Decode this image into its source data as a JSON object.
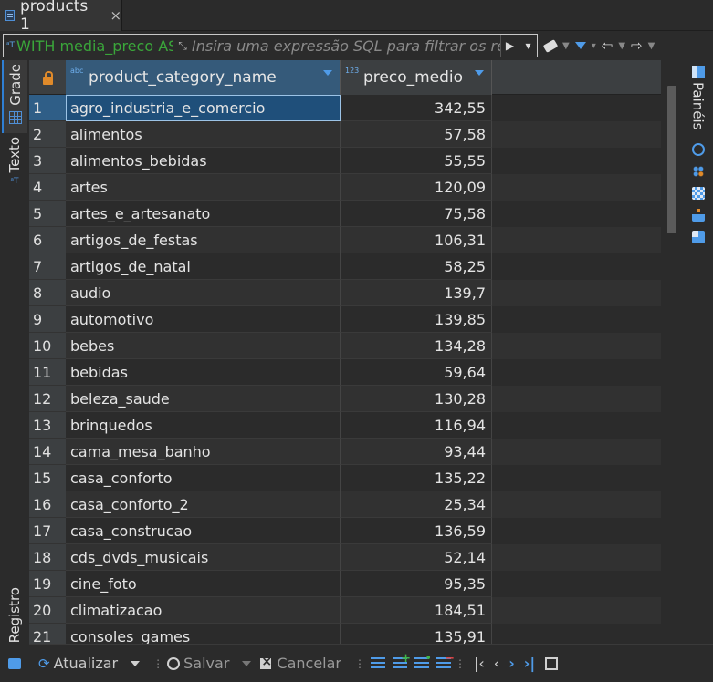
{
  "tab": {
    "title": "products 1",
    "close": "×"
  },
  "filter": {
    "sql_icon": "sql-text-icon",
    "sql_text": "WITH media_preco AS",
    "placeholder": "Insira uma expressão SQL para filtrar os resultados"
  },
  "left_tabs": {
    "grade": "Grade",
    "texto": "Texto",
    "registro": "Registro"
  },
  "right_panel": {
    "label": "Painéis"
  },
  "columns": [
    {
      "type_badge": "abc",
      "name": "product_category_name"
    },
    {
      "type_badge": "123",
      "name": "preco_medio"
    }
  ],
  "rows": [
    {
      "n": "1",
      "category": "agro_industria_e_comercio",
      "price": "342,55"
    },
    {
      "n": "2",
      "category": "alimentos",
      "price": "57,58"
    },
    {
      "n": "3",
      "category": "alimentos_bebidas",
      "price": "55,55"
    },
    {
      "n": "4",
      "category": "artes",
      "price": "120,09"
    },
    {
      "n": "5",
      "category": "artes_e_artesanato",
      "price": "75,58"
    },
    {
      "n": "6",
      "category": "artigos_de_festas",
      "price": "106,31"
    },
    {
      "n": "7",
      "category": "artigos_de_natal",
      "price": "58,25"
    },
    {
      "n": "8",
      "category": "audio",
      "price": "139,7"
    },
    {
      "n": "9",
      "category": "automotivo",
      "price": "139,85"
    },
    {
      "n": "10",
      "category": "bebes",
      "price": "134,28"
    },
    {
      "n": "11",
      "category": "bebidas",
      "price": "59,64"
    },
    {
      "n": "12",
      "category": "beleza_saude",
      "price": "130,28"
    },
    {
      "n": "13",
      "category": "brinquedos",
      "price": "116,94"
    },
    {
      "n": "14",
      "category": "cama_mesa_banho",
      "price": "93,44"
    },
    {
      "n": "15",
      "category": "casa_conforto",
      "price": "135,22"
    },
    {
      "n": "16",
      "category": "casa_conforto_2",
      "price": "25,34"
    },
    {
      "n": "17",
      "category": "casa_construcao",
      "price": "136,59"
    },
    {
      "n": "18",
      "category": "cds_dvds_musicais",
      "price": "52,14"
    },
    {
      "n": "19",
      "category": "cine_foto",
      "price": "95,35"
    },
    {
      "n": "20",
      "category": "climatizacao",
      "price": "184,51"
    },
    {
      "n": "21",
      "category": "consoles_games",
      "price": "135,91"
    }
  ],
  "bottom": {
    "refresh": "Atualizar",
    "save": "Salvar",
    "cancel": "Cancelar"
  },
  "colors": {
    "accent": "#4f9be8",
    "selection": "#1f4f7a",
    "lock": "#e08a2a",
    "sql_green": "#3aa53a"
  }
}
